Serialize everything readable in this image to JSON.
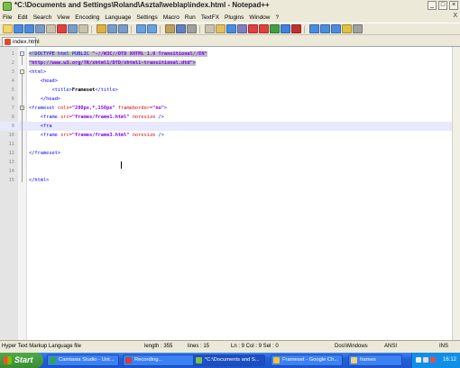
{
  "window": {
    "title": "*C:\\Documents and Settings\\Roland\\Asztal\\weblap\\index.html - Notepad++"
  },
  "menu": [
    "File",
    "Edit",
    "Search",
    "View",
    "Encoding",
    "Language",
    "Settings",
    "Macro",
    "Run",
    "TextFX",
    "Plugins",
    "Window",
    "?"
  ],
  "menu_close": "X",
  "tab": {
    "label": "index.html"
  },
  "lines": [
    {
      "n": "1",
      "parts": [
        {
          "t": "<!DOCTYPE html PUBLIC ",
          "c": "tag hl"
        },
        {
          "t": "\"-//W3C//DTD XHTML 1.0 Transitional//EN\"",
          "c": "str hl"
        }
      ]
    },
    {
      "n": "2",
      "parts": [
        {
          "t": "\"http://www.w3.org/TR/xhtml1/DTD/xhtml1-transitional.dtd\"",
          "c": "str hl"
        },
        {
          "t": ">",
          "c": "tag hl"
        }
      ]
    },
    {
      "n": "3",
      "parts": [
        {
          "t": "<html>",
          "c": "tag"
        }
      ]
    },
    {
      "n": "4",
      "parts": [
        {
          "t": "    <head>",
          "c": "tag"
        }
      ]
    },
    {
      "n": "5",
      "parts": [
        {
          "t": "        <title>",
          "c": "tag"
        },
        {
          "t": "Frameset",
          "c": "txt"
        },
        {
          "t": "</title>",
          "c": "tag"
        }
      ]
    },
    {
      "n": "6",
      "parts": [
        {
          "t": "    </head>",
          "c": "tag"
        }
      ]
    },
    {
      "n": "7",
      "parts": [
        {
          "t": "<frameset ",
          "c": "tag"
        },
        {
          "t": "cols=",
          "c": "attr"
        },
        {
          "t": "\"200px,*,150px\"",
          "c": "str"
        },
        {
          "t": " frameborder=",
          "c": "attr"
        },
        {
          "t": "\"no\"",
          "c": "str"
        },
        {
          "t": ">",
          "c": "tag"
        }
      ]
    },
    {
      "n": "8",
      "parts": [
        {
          "t": "    <frame ",
          "c": "tag"
        },
        {
          "t": "src=",
          "c": "attr"
        },
        {
          "t": "\"frames/frame1.html\"",
          "c": "str"
        },
        {
          "t": " noresize ",
          "c": "attr"
        },
        {
          "t": "/>",
          "c": "tag"
        }
      ]
    },
    {
      "n": "9",
      "parts": [
        {
          "t": "    <fra",
          "c": "tag"
        }
      ]
    },
    {
      "n": "10",
      "parts": [
        {
          "t": "    <frame ",
          "c": "tag"
        },
        {
          "t": "src=",
          "c": "attr"
        },
        {
          "t": "\"frames/frame3.html\"",
          "c": "str"
        },
        {
          "t": " noresize ",
          "c": "attr"
        },
        {
          "t": "/>",
          "c": "tag"
        }
      ]
    },
    {
      "n": "11",
      "parts": []
    },
    {
      "n": "12",
      "parts": [
        {
          "t": "</frameset>",
          "c": "tag"
        }
      ]
    },
    {
      "n": "13",
      "parts": []
    },
    {
      "n": "14",
      "parts": []
    },
    {
      "n": "15",
      "parts": [
        {
          "t": "</html>",
          "c": "tag"
        }
      ]
    }
  ],
  "status": {
    "filetype": "Hyper Text Markup Language file",
    "length": "length : 355",
    "lines": "lines : 15",
    "position": "Ln : 9   Col : 9   Sel : 0",
    "eol": "Dos\\Windows",
    "encoding": "ANSI",
    "mode": "INS"
  },
  "taskbar": {
    "start": "Start",
    "tasks": [
      {
        "label": "Camtasia Studio - Unt...",
        "color": "#2aa84a"
      },
      {
        "label": "Recording...",
        "color": "#d04040"
      },
      {
        "label": "*C:\\Documents and S...",
        "color": "#7ac04a",
        "active": true
      },
      {
        "label": "Frameset - Google Ch...",
        "color": "#f2c230"
      },
      {
        "label": "frames",
        "color": "#f0d070"
      }
    ],
    "clock": "16:12"
  },
  "colors": {
    "titlebar_bg": "#ece9d8",
    "taskbar": "#245edb",
    "start": "#3a8c33",
    "selection": "#c0c0c0",
    "current_line": "#e8e8ff"
  }
}
